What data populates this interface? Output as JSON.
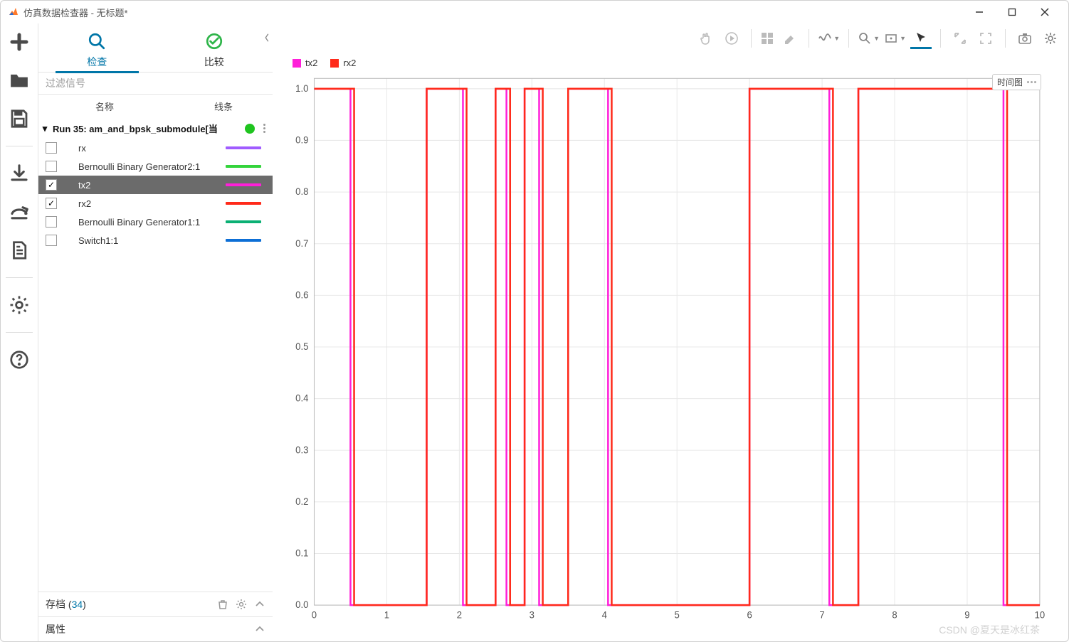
{
  "window": {
    "title": "仿真数据检查器 - 无标题*"
  },
  "panel": {
    "tabs": {
      "inspect": "检查",
      "compare": "比较"
    },
    "filter_placeholder": "过滤信号",
    "columns": {
      "name": "名称",
      "line": "线条"
    },
    "run": {
      "label": "Run 35: am_and_bpsk_submodule[当"
    },
    "signals": [
      {
        "name": "rx",
        "checked": false,
        "selected": false,
        "color": "#a05cff"
      },
      {
        "name": "Bernoulli Binary Generator2:1",
        "checked": false,
        "selected": false,
        "color": "#34d43c"
      },
      {
        "name": "tx2",
        "checked": true,
        "selected": true,
        "color": "#ff1fd9"
      },
      {
        "name": "rx2",
        "checked": true,
        "selected": false,
        "color": "#ff2a1a"
      },
      {
        "name": "Bernoulli Binary Generator1:1",
        "checked": false,
        "selected": false,
        "color": "#0ab074"
      },
      {
        "name": "Switch1:1",
        "checked": false,
        "selected": false,
        "color": "#0d6fd6"
      }
    ],
    "archive": {
      "label": "存档 (",
      "count": "34",
      "suffix": ")"
    },
    "props": "属性"
  },
  "plot": {
    "legend": [
      {
        "label": "tx2",
        "color": "#ff1fd9"
      },
      {
        "label": "rx2",
        "color": "#ff2a1a"
      }
    ],
    "badge": "时间图"
  },
  "chart_data": {
    "type": "line",
    "xlabel": "",
    "ylabel": "",
    "xlim": [
      0,
      10
    ],
    "ylim": [
      0,
      1.02
    ],
    "xticks": [
      0,
      1,
      2,
      3,
      4,
      5,
      6,
      7,
      8,
      9,
      10
    ],
    "yticks": [
      0,
      0.1,
      0.2,
      0.3,
      0.4,
      0.5,
      0.6,
      0.7,
      0.8,
      0.9,
      1.0
    ],
    "series": [
      {
        "name": "tx2",
        "color": "#ff1fd9",
        "transitions": [
          [
            0.0,
            1
          ],
          [
            0.5,
            0
          ],
          [
            1.55,
            1
          ],
          [
            2.05,
            0
          ],
          [
            2.5,
            1
          ],
          [
            2.65,
            0
          ],
          [
            2.9,
            1
          ],
          [
            3.1,
            0
          ],
          [
            3.5,
            1
          ],
          [
            4.05,
            0
          ],
          [
            6.0,
            1
          ],
          [
            7.1,
            0
          ],
          [
            7.5,
            1
          ],
          [
            9.5,
            0
          ]
        ]
      },
      {
        "name": "rx2",
        "color": "#ff2a1a",
        "transitions": [
          [
            0.0,
            1
          ],
          [
            0.55,
            0
          ],
          [
            1.55,
            1
          ],
          [
            2.1,
            0
          ],
          [
            2.5,
            1
          ],
          [
            2.7,
            0
          ],
          [
            2.9,
            1
          ],
          [
            3.15,
            0
          ],
          [
            3.5,
            1
          ],
          [
            4.1,
            0
          ],
          [
            6.0,
            1
          ],
          [
            7.15,
            0
          ],
          [
            7.5,
            1
          ],
          [
            9.55,
            0
          ]
        ]
      }
    ]
  },
  "watermark": "CSDN @夏天是冰红茶"
}
